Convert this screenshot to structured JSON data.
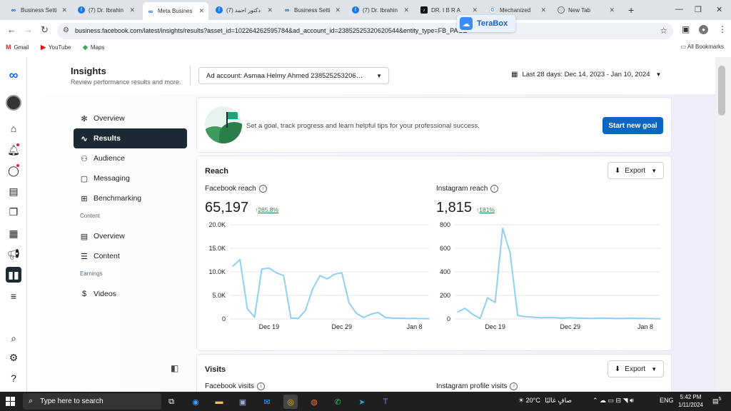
{
  "browser": {
    "tabs": [
      {
        "title": "Business Setti",
        "icon": "meta-icon",
        "active": false
      },
      {
        "title": "(7) Dr. Ibrahin",
        "icon": "facebook-icon",
        "active": false
      },
      {
        "title": "Meta Busines",
        "icon": "meta-icon",
        "active": true
      },
      {
        "title": "(7) دكتور احمد",
        "icon": "facebook-icon",
        "active": false
      },
      {
        "title": "Business Setti",
        "icon": "meta-icon",
        "active": false
      },
      {
        "title": "(7) Dr. Ibrahin",
        "icon": "facebook-icon",
        "active": false
      },
      {
        "title": "DR. I B R A",
        "icon": "tiktok-icon",
        "active": false
      },
      {
        "title": "Mechanized",
        "icon": "google-icon",
        "active": false
      },
      {
        "title": "New Tab",
        "icon": "globe-icon",
        "active": false
      }
    ],
    "url": "business.facebook.com/latest/insights/results?asset_id=102264262595784&ad_account_id=23852525320620544&entity_type=FB_PAGE",
    "terabox_label": "TeraBox",
    "bookmarks": [
      {
        "label": "Gmail"
      },
      {
        "label": "YouTube"
      },
      {
        "label": "Maps"
      }
    ],
    "all_bookmarks": "All Bookmarks"
  },
  "header": {
    "title": "Insights",
    "subtitle": "Review performance results and more.",
    "ad_account": "Ad account: Asmaa Helmy Ahmed 238525253206…",
    "date_range": "Last 28 days: Dec 14, 2023 - Jan 10, 2024"
  },
  "sidenav": {
    "items": [
      {
        "label": "Overview",
        "icon": "overview-icon"
      },
      {
        "label": "Results",
        "icon": "results-icon"
      },
      {
        "label": "Audience",
        "icon": "audience-icon"
      },
      {
        "label": "Messaging",
        "icon": "messaging-icon"
      },
      {
        "label": "Benchmarking",
        "icon": "benchmarking-icon"
      }
    ],
    "content_heading": "Content",
    "content_items": [
      {
        "label": "Overview",
        "icon": "content-overview-icon"
      },
      {
        "label": "Content",
        "icon": "content-icon"
      }
    ],
    "earnings_heading": "Earnings",
    "earnings_items": [
      {
        "label": "Videos",
        "icon": "videos-icon"
      }
    ]
  },
  "goal_card": {
    "text": "Set a goal, track progress and learn helpful tips for your professional success.",
    "button": "Start new goal"
  },
  "reach": {
    "title": "Reach",
    "export_label": "Export",
    "facebook": {
      "label": "Facebook reach",
      "value": "65,197",
      "change": "265.8%"
    },
    "instagram": {
      "label": "Instagram reach",
      "value": "1,815",
      "change": "181%"
    }
  },
  "visits": {
    "title": "Visits",
    "export_label": "Export",
    "facebook_label": "Facebook visits",
    "instagram_label": "Instagram profile visits"
  },
  "chart_data": [
    {
      "type": "line",
      "ylim": [
        0,
        20000
      ],
      "yticks": [
        "20.0K",
        "15.0K",
        "10.0K",
        "5.0K",
        "0"
      ],
      "ytick_values": [
        20000,
        15000,
        10000,
        5000,
        0
      ],
      "xticks": [
        {
          "label": "Dec 19",
          "index": 5
        },
        {
          "label": "Dec 29",
          "index": 15
        },
        {
          "label": "Jan 8",
          "index": 25
        }
      ],
      "color": "#8fd0f2",
      "series": [
        {
          "values": [
            11200,
            12600,
            2200,
            400,
            10600,
            10800,
            9800,
            9200,
            200,
            100,
            1800,
            6400,
            9200,
            8500,
            9500,
            9800,
            3400,
            1200,
            300,
            1000,
            1400,
            300,
            200,
            150,
            120,
            100,
            80,
            60
          ]
        }
      ]
    },
    {
      "type": "line",
      "ylim": [
        0,
        800
      ],
      "yticks": [
        "800",
        "600",
        "400",
        "200",
        "0"
      ],
      "ytick_values": [
        800,
        600,
        400,
        200,
        0
      ],
      "xticks": [
        {
          "label": "Dec 19",
          "index": 5
        },
        {
          "label": "Dec 29",
          "index": 15
        },
        {
          "label": "Jan 8",
          "index": 25
        }
      ],
      "color": "#8fd0f2",
      "series": [
        {
          "values": [
            60,
            90,
            40,
            5,
            180,
            140,
            770,
            560,
            30,
            20,
            15,
            10,
            12,
            10,
            8,
            10,
            8,
            6,
            5,
            8,
            6,
            5,
            4,
            6,
            5,
            4,
            3,
            2
          ]
        }
      ]
    }
  ],
  "taskbar": {
    "search_placeholder": "Type here to search",
    "weather": "20°C",
    "weather_text": "صافٍ غالبًا",
    "lang": "ENG",
    "time": "5:42 PM",
    "date": "1/11/2024",
    "notif_count": "5"
  }
}
